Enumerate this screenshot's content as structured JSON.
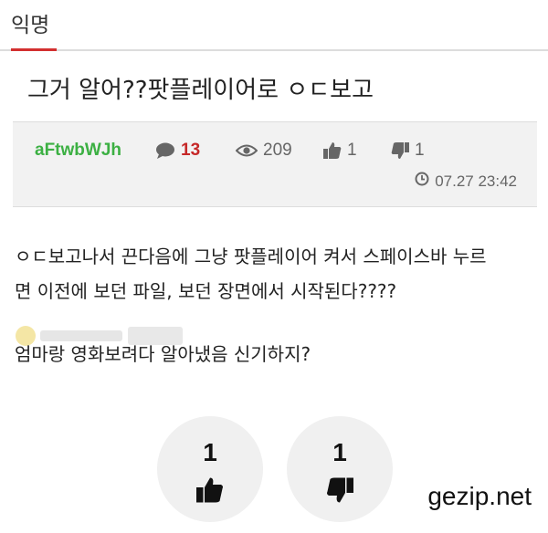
{
  "tab": {
    "label": "익명"
  },
  "post": {
    "title": "그거 알어??팟플레이어로 ㅇㄷ보고",
    "author": "aFtwbWJh",
    "comments": "13",
    "views": "209",
    "likes": "1",
    "dislikes": "1",
    "timestamp": "07.27 23:42",
    "body": {
      "line1": "ㅇㄷ보고나서 끈다음에 그냥 팟플레이어 켜서 스페이스바 누르",
      "line2": "면 이전에 보던 파일, 보던 장면에서 시작된다????",
      "line3": "엄마랑 영화보려다 알아냈음 신기하지?"
    }
  },
  "votes": {
    "up": "1",
    "down": "1"
  },
  "watermark": {
    "text": "gezip.net"
  },
  "colors": {
    "accent": "#d32f2f",
    "author": "#3cb043",
    "comment_count": "#c62828",
    "meta_bg": "#f2f2f2",
    "vote_bg": "#f0f0f0"
  }
}
